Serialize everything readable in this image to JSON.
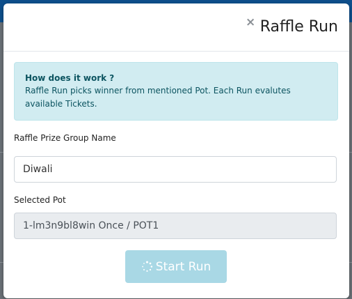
{
  "modal": {
    "close_symbol": "×",
    "title": "Raffle Run",
    "info": {
      "heading": "How does it work ?",
      "body": "Raffle Run picks winner from mentioned Pot. Each Run evalutes available Tickets."
    },
    "fields": {
      "prize_group_label": "Raffle Prize Group Name",
      "prize_group_value": "Diwali",
      "selected_pot_label": "Selected Pot",
      "selected_pot_value": "1-lm3n9bl8win Once / POT1"
    },
    "start_button_label": "Start Run",
    "start_button_icon": "spinner-icon"
  },
  "colors": {
    "header_bg": "#0e4f8c",
    "info_bg": "#d1ecf1",
    "info_text": "#0c5460",
    "button_bg": "#a9d8e5",
    "readonly_bg": "#e9ecef"
  }
}
